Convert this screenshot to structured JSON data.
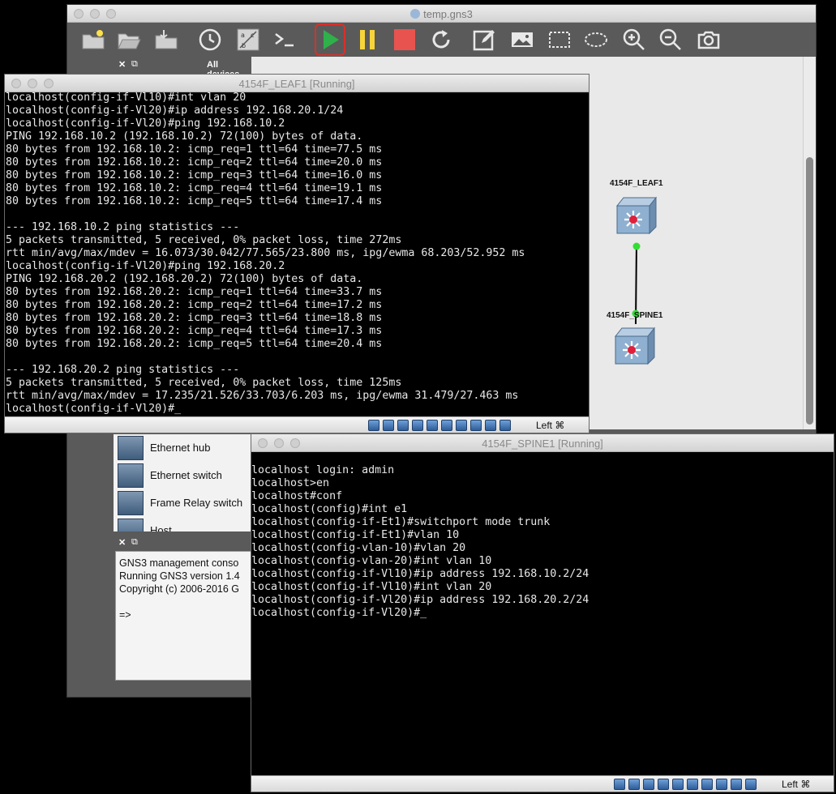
{
  "gns3": {
    "title": "temp.gns3",
    "devices_panel_title": "All devices",
    "toolbar": [
      {
        "name": "new-project-button",
        "icon": "folder-new-icon"
      },
      {
        "name": "open-project-button",
        "icon": "folder-open-icon"
      },
      {
        "name": "save-project-button",
        "icon": "folder-save-icon"
      },
      {
        "name": "snapshot-button",
        "icon": "clock-icon"
      },
      {
        "name": "show-interface-labels-button",
        "icon": "abc-labels-icon"
      },
      {
        "name": "console-all-button",
        "icon": "terminal-icon"
      },
      {
        "name": "start-all-button",
        "icon": "play-icon"
      },
      {
        "name": "suspend-all-button",
        "icon": "pause-icon"
      },
      {
        "name": "stop-all-button",
        "icon": "stop-icon"
      },
      {
        "name": "reload-all-button",
        "icon": "reload-icon"
      },
      {
        "name": "add-note-button",
        "icon": "note-edit-icon"
      },
      {
        "name": "insert-picture-button",
        "icon": "picture-icon"
      },
      {
        "name": "draw-rectangle-button",
        "icon": "rectangle-icon"
      },
      {
        "name": "draw-ellipse-button",
        "icon": "ellipse-icon"
      },
      {
        "name": "zoom-in-button",
        "icon": "zoom-in-icon"
      },
      {
        "name": "zoom-out-button",
        "icon": "zoom-out-icon"
      },
      {
        "name": "screenshot-button",
        "icon": "camera-icon"
      }
    ],
    "nodes": {
      "leaf": {
        "label": "4154F_LEAF1"
      },
      "spine": {
        "label": "4154F_SPINE1"
      }
    },
    "devices": [
      "Ethernet hub",
      "Ethernet switch",
      "Frame Relay switch",
      "Host"
    ],
    "console_text": "GNS3 management conso\nRunning GNS3 version 1.4\nCopyright (c) 2006-2016 G\n\n=>",
    "colors": {
      "start": "#2fb04a",
      "pause": "#f5d53a",
      "stop": "#e8534f",
      "link_status": "#33dd33",
      "node_center": "#e0203a"
    }
  },
  "leaf_terminal": {
    "title": "4154F_LEAF1 [Running]",
    "lines": "localhost(config-if-Vl10)#int vlan 20\nlocalhost(config-if-Vl20)#ip address 192.168.20.1/24\nlocalhost(config-if-Vl20)#ping 192.168.10.2\nPING 192.168.10.2 (192.168.10.2) 72(100) bytes of data.\n80 bytes from 192.168.10.2: icmp_req=1 ttl=64 time=77.5 ms\n80 bytes from 192.168.10.2: icmp_req=2 ttl=64 time=20.0 ms\n80 bytes from 192.168.10.2: icmp_req=3 ttl=64 time=16.0 ms\n80 bytes from 192.168.10.2: icmp_req=4 ttl=64 time=19.1 ms\n80 bytes from 192.168.10.2: icmp_req=5 ttl=64 time=17.4 ms\n\n--- 192.168.10.2 ping statistics ---\n5 packets transmitted, 5 received, 0% packet loss, time 272ms\nrtt min/avg/max/mdev = 16.073/30.042/77.565/23.800 ms, ipg/ewma 68.203/52.952 ms\nlocalhost(config-if-Vl20)#ping 192.168.20.2\nPING 192.168.20.2 (192.168.20.2) 72(100) bytes of data.\n80 bytes from 192.168.20.2: icmp_req=1 ttl=64 time=33.7 ms\n80 bytes from 192.168.20.2: icmp_req=2 ttl=64 time=17.2 ms\n80 bytes from 192.168.20.2: icmp_req=3 ttl=64 time=18.8 ms\n80 bytes from 192.168.20.2: icmp_req=4 ttl=64 time=17.3 ms\n80 bytes from 192.168.20.2: icmp_req=5 ttl=64 time=20.4 ms\n\n--- 192.168.20.2 ping statistics ---\n5 packets transmitted, 5 received, 0% packet loss, time 125ms\nrtt min/avg/max/mdev = 17.235/21.526/33.703/6.203 ms, ipg/ewma 31.479/27.463 ms\nlocalhost(config-if-Vl20)#_",
    "host_key": "Left ⌘"
  },
  "spine_terminal": {
    "title": "4154F_SPINE1 [Running]",
    "lines": "\nlocalhost login: admin\nlocalhost>en\nlocalhost#conf\nlocalhost(config)#int e1\nlocalhost(config-if-Et1)#switchport mode trunk\nlocalhost(config-if-Et1)#vlan 10\nlocalhost(config-vlan-10)#vlan 20\nlocalhost(config-vlan-20)#int vlan 10\nlocalhost(config-if-Vl10)#ip address 192.168.10.2/24\nlocalhost(config-if-Vl10)#int vlan 20\nlocalhost(config-if-Vl20)#ip address 192.168.20.2/24\nlocalhost(config-if-Vl20)#_",
    "host_key": "Left ⌘"
  }
}
